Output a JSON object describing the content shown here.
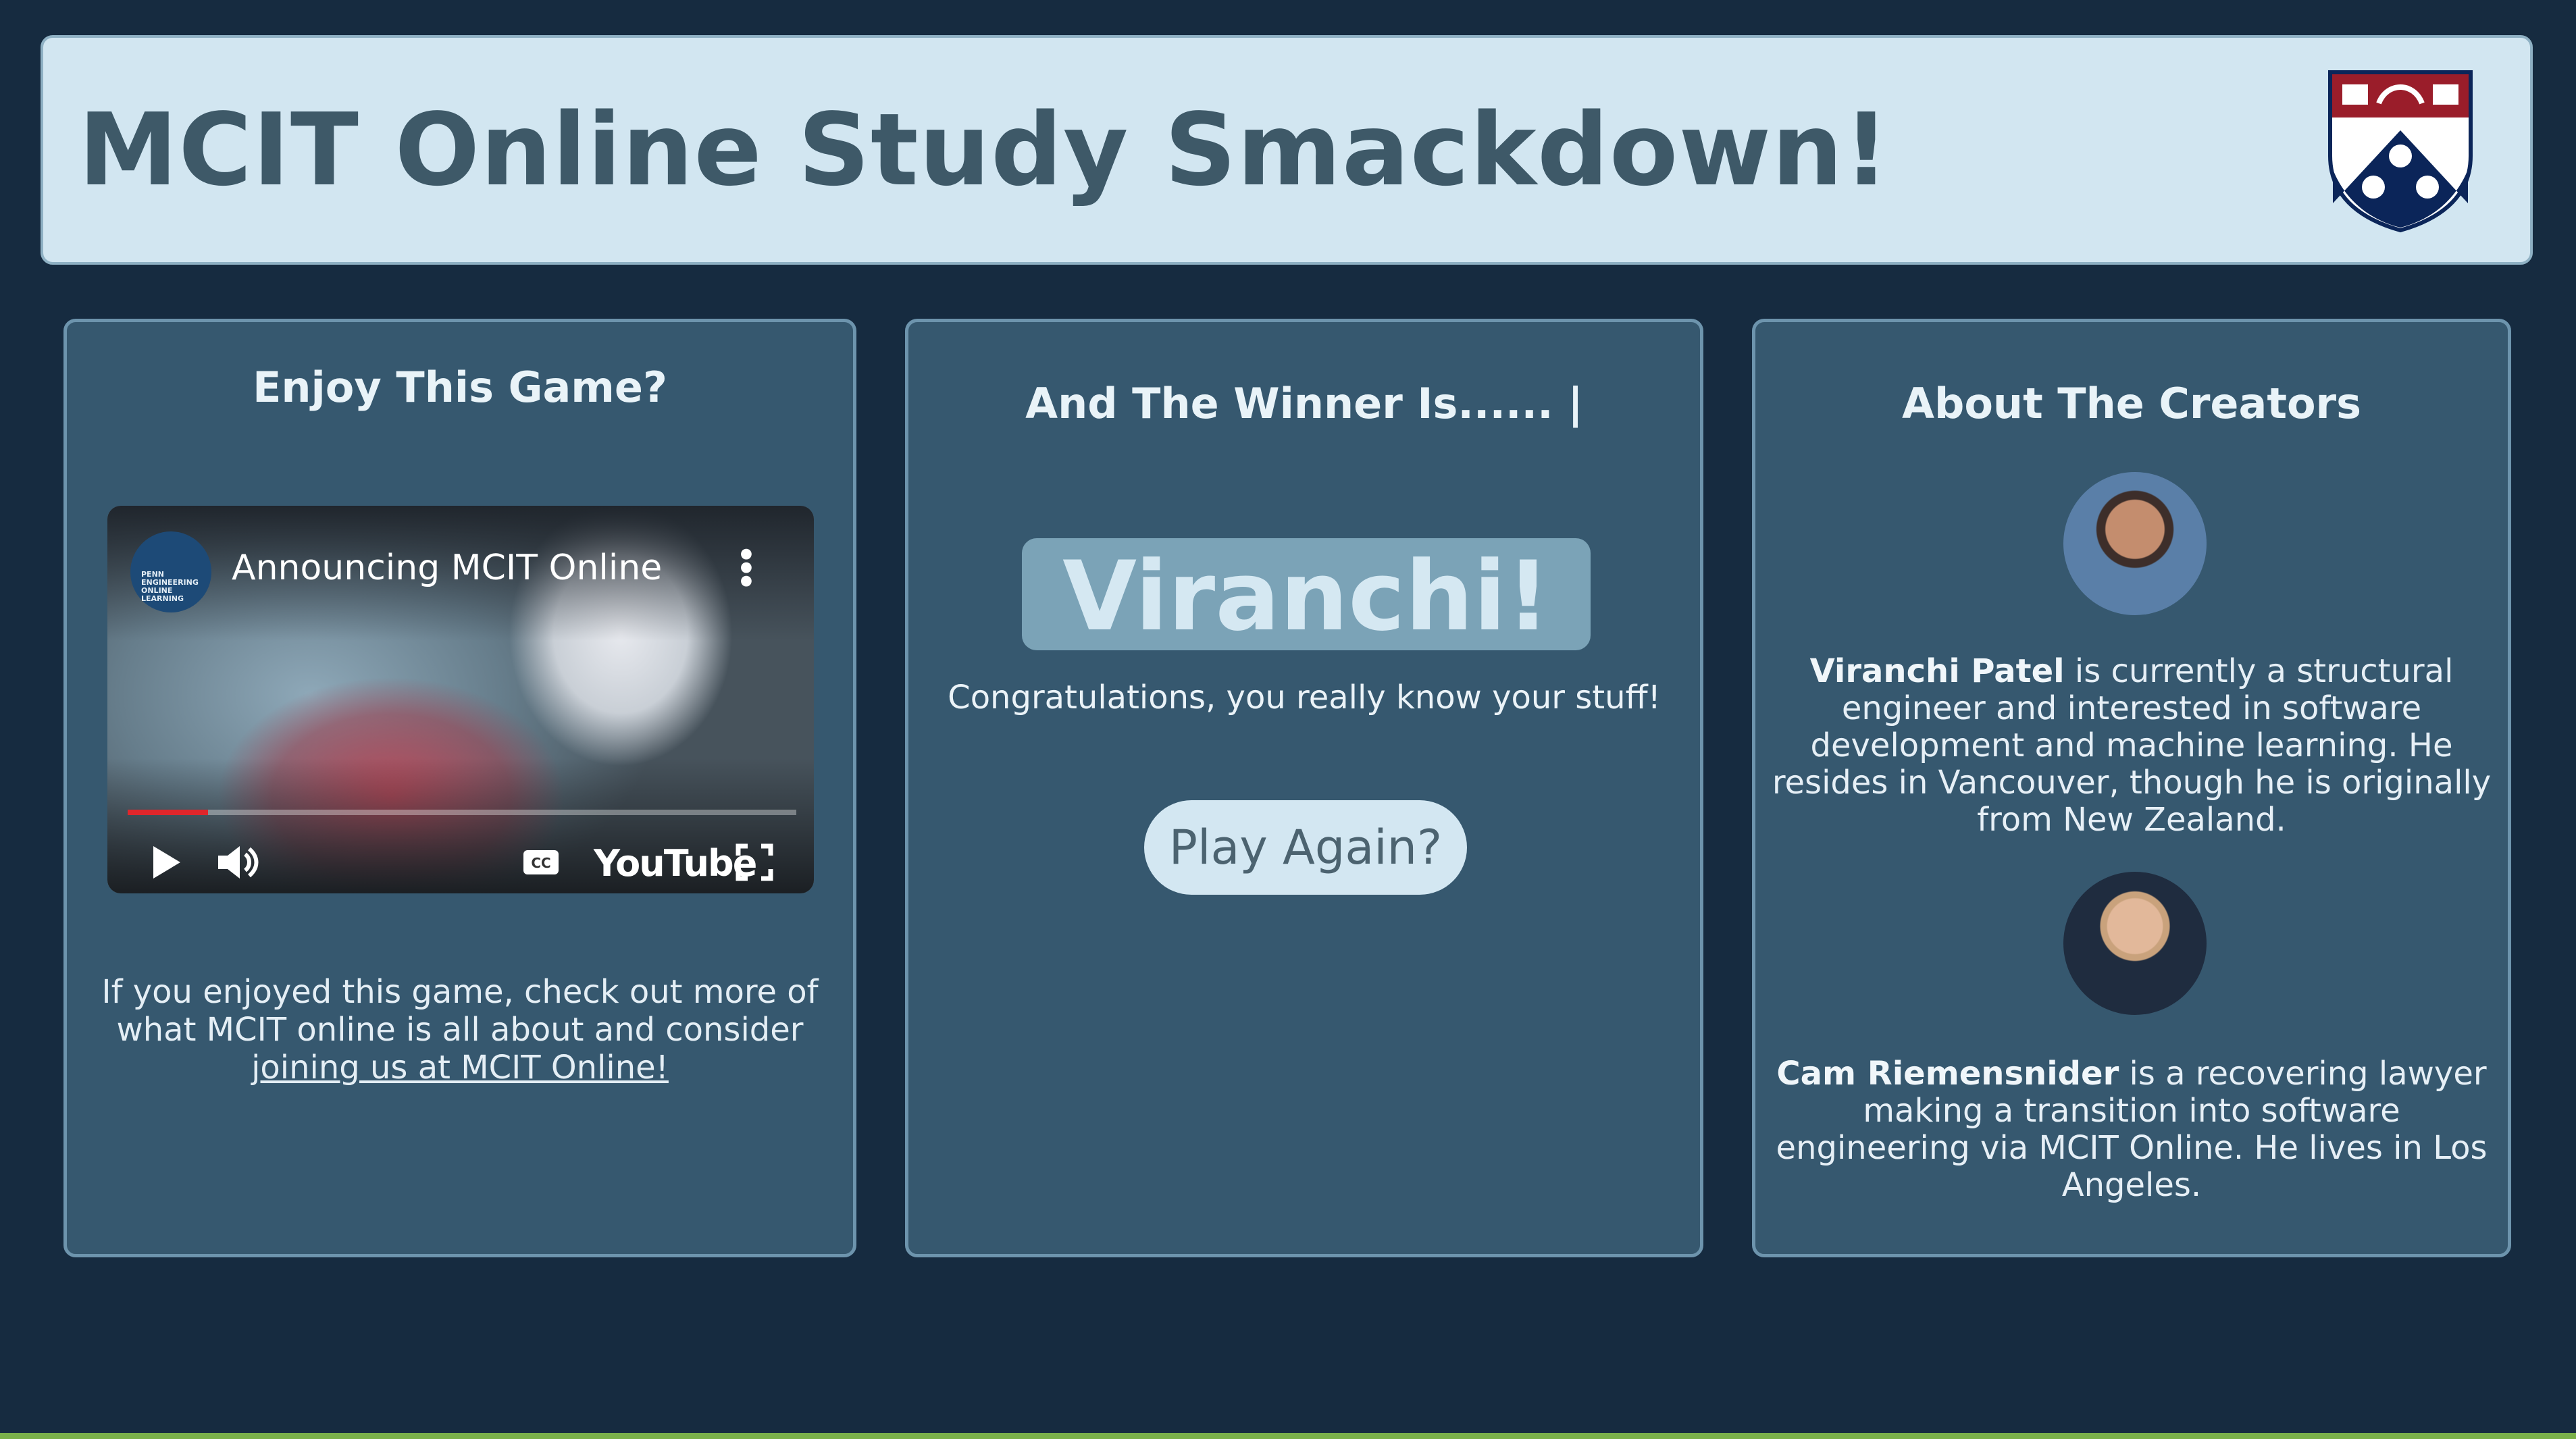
{
  "header": {
    "title": "MCIT Online Study Smackdown!"
  },
  "left_panel": {
    "title": "Enjoy This Game?",
    "video": {
      "title": "Announcing MCIT Online",
      "channel_logo_text": "PENN ENGINEERING ONLINE LEARNING",
      "youtube_label": "YouTube",
      "progress_percent": 12
    },
    "text": "If you enjoyed this game, check out more of what MCIT online is all about and consider",
    "link_text": "joining us at MCIT Online!"
  },
  "center_panel": {
    "title": "And The Winner Is...... |",
    "winner": "Viranchi!",
    "congrats": "Congratulations, you really know your stuff!",
    "play_again": "Play Again?"
  },
  "right_panel": {
    "title": "About The Creators",
    "creators": [
      {
        "name": "Viranchi Patel",
        "bio": " is currently a structural engineer and interested in software development and machine learning. He resides in Vancouver, though he is originally from New Zealand."
      },
      {
        "name": "Cam Riemensnider",
        "bio": " is a recovering lawyer making a transition into software engineering via MCIT Online. He lives in Los Angeles."
      }
    ]
  },
  "colors": {
    "background": "#162b40",
    "panel": "#36586f",
    "header": "#d2e6f1",
    "winner_box": "#7ba3b7",
    "accent_bottom": "#7ab04a"
  }
}
